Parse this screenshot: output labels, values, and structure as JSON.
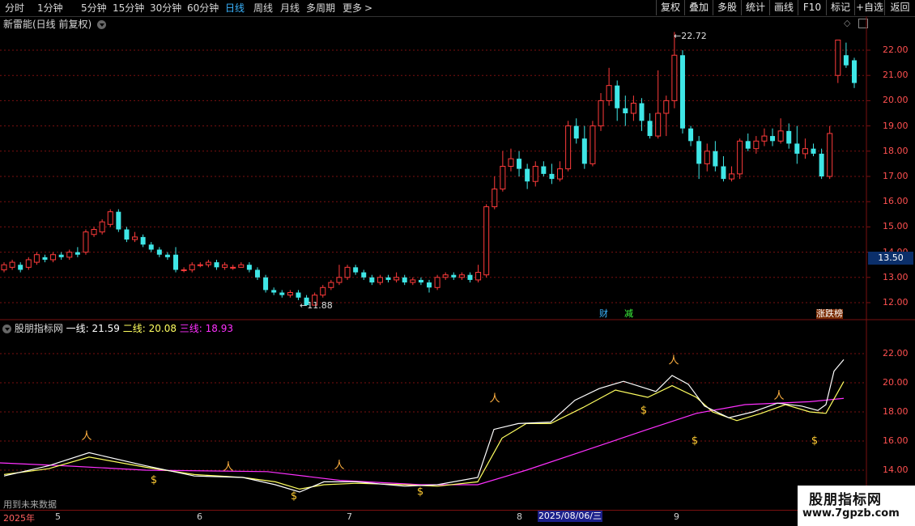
{
  "toolbar": {
    "periods": [
      "分时",
      "1分钟",
      "5分钟",
      "15分钟",
      "30分钟",
      "60分钟",
      "日线",
      "周线",
      "月线",
      "多周期",
      "更多"
    ],
    "active_period": "日线",
    "right_buttons": [
      "复权",
      "叠加",
      "多股",
      "统计",
      "画线",
      "F10",
      "标记",
      "+自选",
      "返回"
    ]
  },
  "main_chart": {
    "title": "新雷能(日线 前复权)",
    "price_labels": [
      "22.00",
      "21.00",
      "20.00",
      "19.00",
      "18.00",
      "17.00",
      "16.00",
      "15.00",
      "14.00",
      "13.00",
      "12.00"
    ],
    "high_annotation": "22.72",
    "low_annotation": "11.88",
    "current_price": "13.50",
    "badges": [
      "财",
      "减",
      "涨跌榜"
    ]
  },
  "indicator": {
    "name": "股朋指标网",
    "line1_label": "一线:",
    "line1_value": "21.59",
    "line2_label": "二线:",
    "line2_value": "20.08",
    "line3_label": "三线:",
    "line3_value": "18.93",
    "labels": [
      "22.00",
      "20.00",
      "18.00",
      "16.00",
      "14.00"
    ],
    "future_note": "用到未来数据"
  },
  "xaxis": {
    "labels": [
      "2025年",
      "5",
      "6",
      "7",
      "8",
      "9"
    ],
    "cursor_date": "2025/08/06/三"
  },
  "watermark": {
    "title": "股朋指标网",
    "url": "www.7gpzb.com"
  },
  "colors": {
    "up": "#ff3b3b",
    "down": "#3fe6e6",
    "line1": "#ffffff",
    "line2": "#ffff60",
    "line3": "#ff30ff",
    "grid": "#7a1010"
  }
}
